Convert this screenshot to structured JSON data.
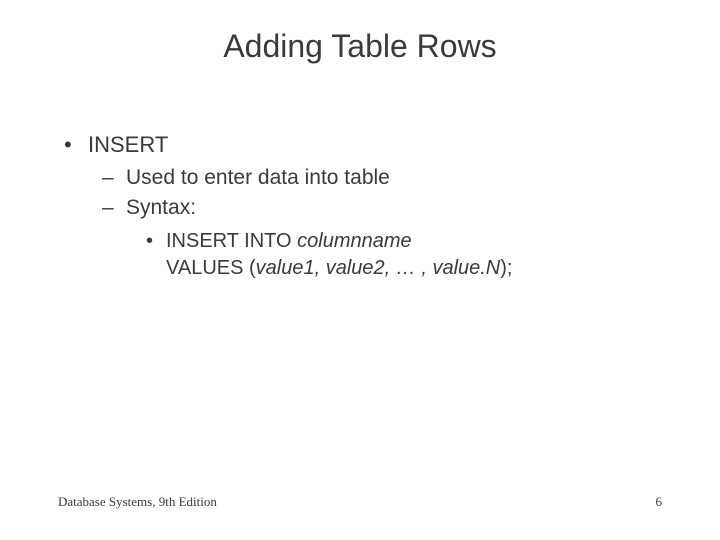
{
  "title": "Adding Table Rows",
  "bullets": {
    "l1a": "INSERT",
    "l2a": "Used to enter data into table",
    "l2b": "Syntax:",
    "l3_pre": "INSERT INTO ",
    "l3_ital": "columnname",
    "l3b_pre": "VALUES (",
    "l3b_ital": "value1, value2, … , value.N",
    "l3b_post": ");"
  },
  "footer": {
    "left": "Database Systems, 9th Edition",
    "right": "6"
  }
}
